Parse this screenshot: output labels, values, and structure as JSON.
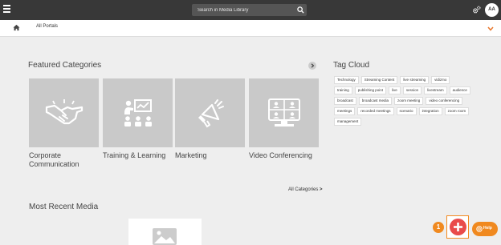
{
  "header": {
    "menu_icon": "hamburger-menu-icon",
    "search": {
      "placeholder": "Search in Media Library",
      "icon": "search-icon"
    },
    "settings_icon": "gear-icon",
    "avatar_initials": "AA"
  },
  "subnav": {
    "home_icon": "home-icon",
    "portal_label": "All Portals",
    "expand_icon": "chevron-down-icon",
    "accent_color": "#e8762c"
  },
  "featured": {
    "title": "Featured Categories",
    "next_icon": "chevron-right-icon",
    "categories": [
      {
        "label": "Corporate Communication",
        "icon": "handshake-icon"
      },
      {
        "label": "Training & Learning",
        "icon": "presentation-icon"
      },
      {
        "label": "Marketing",
        "icon": "megaphone-icon"
      },
      {
        "label": "Video Conferencing",
        "icon": "video-conference-icon"
      }
    ],
    "all_link": "All Categories"
  },
  "tag_cloud": {
    "title": "Tag Cloud",
    "tags": [
      "Technology",
      "Streaming Content",
      "live streaming",
      "vidizmo",
      "training",
      "publishing point",
      "live",
      "session",
      "livestream",
      "audience",
      "broadcast",
      "broadcast media",
      "zoom meeting",
      "video conferencing",
      "meetings",
      "recorded meetings",
      "scenario",
      "integration",
      "zoom room",
      "management"
    ]
  },
  "recent": {
    "title": "Most Recent Media",
    "thumbnail_icon": "image-placeholder-icon"
  },
  "floating": {
    "badge_count": "1",
    "add_icon": "plus-icon",
    "add_color": "#e94b4b",
    "help_label": "Help",
    "help_icon": "help-icon",
    "help_color": "#f0891f"
  }
}
